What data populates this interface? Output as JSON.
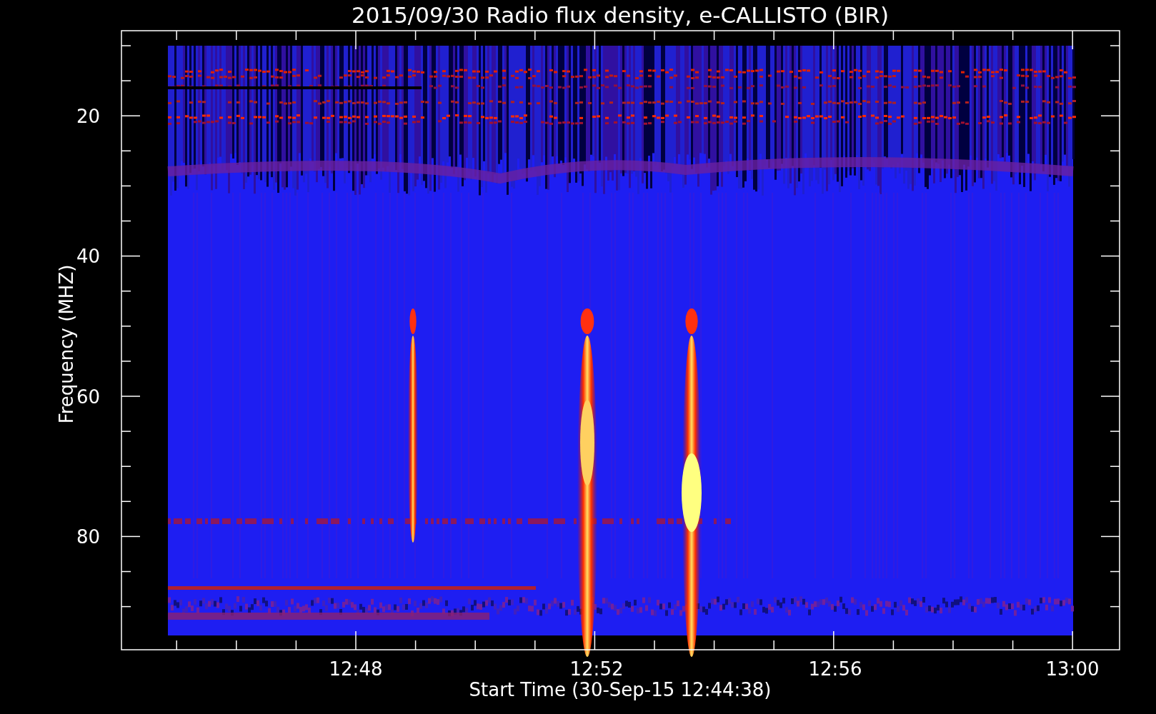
{
  "plot": {
    "title": "2015/09/30  Radio flux density, e-CALLISTO (BIR)",
    "ylabel": "Frequency (MHZ)",
    "xlabel": "Start Time (30-Sep-15 12:44:38)",
    "yticks": [
      "20",
      "40",
      "60",
      "80"
    ],
    "xticks": [
      "12:48",
      "12:52",
      "12:56",
      "13:00"
    ]
  }
}
